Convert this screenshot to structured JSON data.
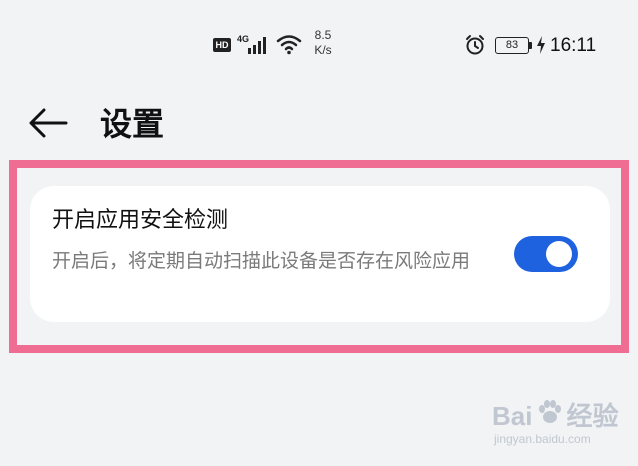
{
  "status_bar": {
    "hd_label": "HD",
    "network_label": "4G",
    "speed_value": "8.5",
    "speed_unit": "K/s",
    "battery_level": "83",
    "time": "16:11",
    "icons": [
      "signal-icon",
      "wifi-icon",
      "alarm-icon",
      "charging-icon"
    ]
  },
  "header": {
    "back_icon": "arrow-left-icon",
    "title": "设置"
  },
  "setting": {
    "title": "开启应用安全检测",
    "description": "开启后，将定期自动扫描此设备是否存在风险应用",
    "toggle_on": true
  },
  "colors": {
    "background": "#f1f3f5",
    "card": "#ffffff",
    "toggle_active": "#1f62e0",
    "highlight": "#ef6d93",
    "description_text": "#7a7a7a"
  },
  "watermark": {
    "logo": "Bai",
    "logo_suffix": "经验",
    "url": "jingyan.baidu.com"
  }
}
